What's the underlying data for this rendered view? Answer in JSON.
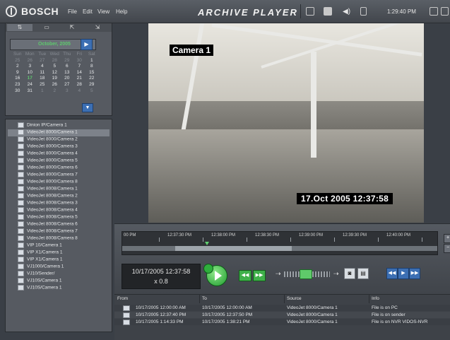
{
  "header": {
    "brand": "BOSCH",
    "menu": [
      "File",
      "Edit",
      "View",
      "Help"
    ],
    "app_title": "ARCHIVE PLAYER",
    "clock": "1:29:40 PM"
  },
  "calendar": {
    "month": "October, 2005",
    "weekdays": [
      "Sun",
      "Mon",
      "Tue",
      "Wed",
      "Thu",
      "Fri",
      "Sat"
    ],
    "weeks": [
      [
        "25",
        "26",
        "27",
        "28",
        "29",
        "30",
        "1"
      ],
      [
        "2",
        "3",
        "4",
        "5",
        "6",
        "7",
        "8"
      ],
      [
        "9",
        "10",
        "11",
        "12",
        "13",
        "14",
        "15"
      ],
      [
        "16",
        "17",
        "18",
        "19",
        "20",
        "21",
        "22"
      ],
      [
        "23",
        "24",
        "25",
        "26",
        "27",
        "28",
        "29"
      ],
      [
        "30",
        "31",
        "1",
        "2",
        "3",
        "4",
        "5"
      ]
    ],
    "today": "17"
  },
  "device_list": [
    "Dinion IP/Camera 1",
    "VideoJet 8000/Camera 1",
    "VideoJet 8000/Camera 2",
    "VideoJet 8000/Camera 3",
    "VideoJet 8000/Camera 4",
    "VideoJet 8000/Camera 5",
    "VideoJet 8000/Camera 6",
    "VideoJet 8000/Camera 7",
    "VideoJet 8000/Camera 8",
    "VideoJet 8008/Camera 1",
    "VideoJet 8008/Camera 2",
    "VideoJet 8008/Camera 3",
    "VideoJet 8008/Camera 4",
    "VideoJet 8008/Camera 5",
    "VideoJet 8008/Camera 6",
    "VideoJet 8008/Camera 7",
    "VideoJet 8008/Camera 8",
    "VIP 10/Camera 1",
    "VIP X1/Camera 1",
    "VIP X1/Camera 1",
    "VJ1000/Camera 1",
    "VJ10/Sender/",
    "VJ10S/Camera 1",
    "VJ10S/Camera 1"
  ],
  "video": {
    "camera_label": "Camera 1",
    "timestamp": "17.Oct 2005   12:37:58"
  },
  "timeline": {
    "labels": [
      "00 PM",
      "12:37:30 PM",
      "12:38:00 PM",
      "12:38:30 PM",
      "12:39:00 PM",
      "12:39:30 PM",
      "12:40:00 PM"
    ]
  },
  "playback": {
    "datetime": "10/17/2005 12:37:58",
    "speed": "x 0.8"
  },
  "results": {
    "headers": [
      "From",
      "To",
      "Source",
      "Info"
    ],
    "rows": [
      {
        "from": "10/17/2005 12:00:00 AM",
        "to": "10/17/2005 12:00:00 AM",
        "source": "VideoJet 8000/Camera 1",
        "info": "File is on PC"
      },
      {
        "from": "10/17/2005 12:37:40 PM",
        "to": "10/17/2005 12:37:50 PM",
        "source": "VideoJet 8000/Camera 1",
        "info": "File is on sender"
      },
      {
        "from": "10/17/2005 1:14:33 PM",
        "to": "10/17/2005 1:38:21 PM",
        "source": "VideoJet 8000/Camera 1",
        "info": "File is on NVR VIDOS-NVR"
      }
    ]
  }
}
